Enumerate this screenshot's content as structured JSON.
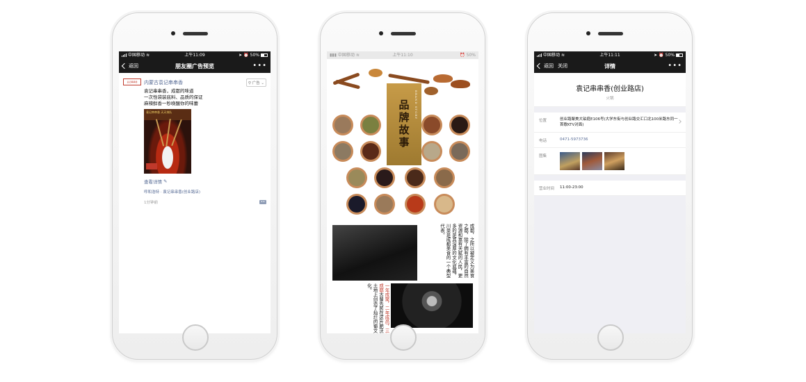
{
  "phones": [
    {
      "status": {
        "carrier": "中国移动",
        "time": "上午11:09",
        "battery": "50%"
      },
      "nav": {
        "back": "返回",
        "title": "朋友圈广告预览",
        "more": "•••"
      },
      "post": {
        "avatar_text": "袁记串串香",
        "name": "内蒙古袁记串串香",
        "ad_tag": "广告",
        "lines": [
          "袁记串串香，成都的味道",
          "一次性袋装底料、品质的保证",
          "麻辣鲜香一秒唤醒你的味蕾"
        ],
        "image_banner": "袁记串串香 天天排队",
        "detail_link": "查看详情",
        "location": "呼和浩特 · 袁记串串香(创业路店)",
        "time": "1分钟前"
      }
    },
    {
      "status": {
        "carrier": "中国移动",
        "time": "上午11:10",
        "battery": "50%"
      },
      "brand": {
        "main": "品牌故事",
        "sub": "BRAND STORY"
      },
      "story": {
        "col1": "成都，之所以被定义为美食之都，除了拥有丰富的自然资源和富有天赋的人民，更多的是其深厚的文化底蕴，川菜是成都美食的一个典型代表。",
        "col2_red": "一年成聚，二年成邑，三年成都",
        "col2": "古蜀先民在这片肥沃的土地上创造了灿烂的蜀文化。"
      }
    },
    {
      "status": {
        "carrier": "中国移动",
        "time": "上午11:11",
        "battery": "50%"
      },
      "nav": {
        "back": "返回",
        "close": "关闭",
        "title": "详情",
        "more": "•••"
      },
      "detail": {
        "title": "袁记串串香(创业路店)",
        "category": "火锅",
        "rows": [
          {
            "label": "位置",
            "value": "创业路聚美大铂庭E106号(大学东街与创业路交汇口北100米路东同一首歌KTV对面)"
          },
          {
            "label": "电话",
            "value": "0471-5973736"
          },
          {
            "label": "图集",
            "value": ""
          },
          {
            "label": "营业时间",
            "value": "11:00-23:00"
          }
        ]
      }
    }
  ]
}
